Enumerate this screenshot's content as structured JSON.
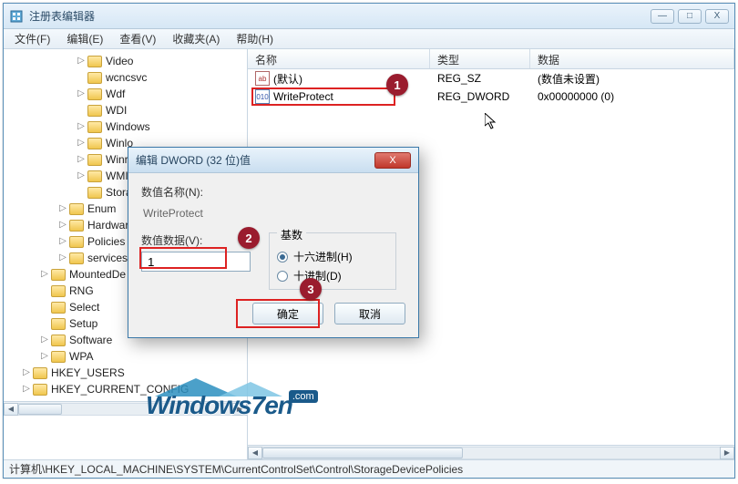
{
  "window": {
    "title": "注册表编辑器"
  },
  "win_controls": {
    "min": "—",
    "max": "□",
    "close": "X"
  },
  "menu": {
    "file": "文件(F)",
    "edit": "编辑(E)",
    "view": "查看(V)",
    "fav": "收藏夹(A)",
    "help": "帮助(H)"
  },
  "tree": [
    {
      "indent": 78,
      "twisty": "▷",
      "label": "Video"
    },
    {
      "indent": 78,
      "twisty": "",
      "label": "wcncsvc"
    },
    {
      "indent": 78,
      "twisty": "▷",
      "label": "Wdf"
    },
    {
      "indent": 78,
      "twisty": "",
      "label": "WDI"
    },
    {
      "indent": 78,
      "twisty": "▷",
      "label": "Windows"
    },
    {
      "indent": 78,
      "twisty": "▷",
      "label": "Winlo"
    },
    {
      "indent": 78,
      "twisty": "▷",
      "label": "Winre"
    },
    {
      "indent": 78,
      "twisty": "▷",
      "label": "WMI"
    },
    {
      "indent": 78,
      "twisty": "",
      "label": "Stora"
    },
    {
      "indent": 58,
      "twisty": "▷",
      "label": "Enum"
    },
    {
      "indent": 58,
      "twisty": "▷",
      "label": "Hardwar"
    },
    {
      "indent": 58,
      "twisty": "▷",
      "label": "Policies"
    },
    {
      "indent": 58,
      "twisty": "▷",
      "label": "services"
    },
    {
      "indent": 38,
      "twisty": "▷",
      "label": "MountedDe"
    },
    {
      "indent": 38,
      "twisty": "",
      "label": "RNG"
    },
    {
      "indent": 38,
      "twisty": "",
      "label": "Select"
    },
    {
      "indent": 38,
      "twisty": "",
      "label": "Setup"
    },
    {
      "indent": 38,
      "twisty": "▷",
      "label": "Software"
    },
    {
      "indent": 38,
      "twisty": "▷",
      "label": "WPA"
    },
    {
      "indent": 18,
      "twisty": "▷",
      "label": "HKEY_USERS"
    },
    {
      "indent": 18,
      "twisty": "▷",
      "label": "HKEY_CURRENT_CONFIG"
    }
  ],
  "columns": {
    "name": "名称",
    "type": "类型",
    "data": "数据"
  },
  "rows": [
    {
      "icon": "ab",
      "name": "(默认)",
      "type": "REG_SZ",
      "data": "(数值未设置)"
    },
    {
      "icon": "dw",
      "name": "WriteProtect",
      "type": "REG_DWORD",
      "data": "0x00000000 (0)"
    }
  ],
  "dialog": {
    "title": "编辑 DWORD (32 位)值",
    "name_label": "数值名称(N):",
    "name_value": "WriteProtect",
    "data_label": "数值数据(V):",
    "data_value": "1",
    "radix_label": "基数",
    "hex": "十六进制(H)",
    "dec": "十进制(D)",
    "ok": "确定",
    "cancel": "取消",
    "close_glyph": "X"
  },
  "annotations": {
    "a1": "1",
    "a2": "2",
    "a3": "3"
  },
  "status": "计算机\\HKEY_LOCAL_MACHINE\\SYSTEM\\CurrentControlSet\\Control\\StorageDevicePolicies",
  "logo": {
    "text": "Windows7en",
    "sup": ".com"
  }
}
